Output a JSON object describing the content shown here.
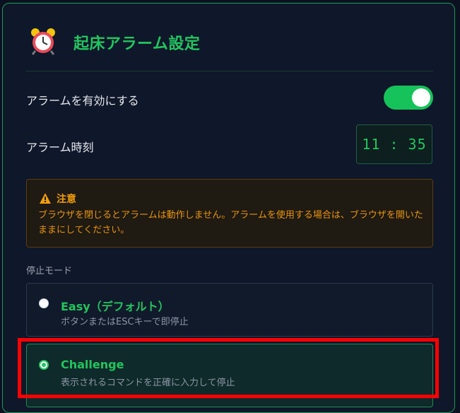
{
  "header": {
    "icon": "alarm-clock-icon",
    "title": "起床アラーム設定"
  },
  "alarm_enable": {
    "label": "アラームを有効にする",
    "enabled": true
  },
  "alarm_time": {
    "label": "アラーム時刻",
    "value": "11 : 35"
  },
  "warning": {
    "icon": "warning-triangle-icon",
    "title": "注意",
    "text": "ブラウザを閉じるとアラームは動作しません。アラームを使用する場合は、ブラウザを開いたままにしてください。"
  },
  "stop_mode": {
    "label": "停止モード",
    "selected": "challenge",
    "options": [
      {
        "id": "easy",
        "title": "Easy（デフォルト）",
        "description": "ボタンまたはESCキーで即停止"
      },
      {
        "id": "challenge",
        "title": "Challenge",
        "description": "表示されるコマンドを正確に入力して停止"
      }
    ]
  },
  "colors": {
    "accent": "#22c55e",
    "warning": "#f59e0b",
    "highlight": "#ff0000",
    "background": "#0f172a"
  }
}
